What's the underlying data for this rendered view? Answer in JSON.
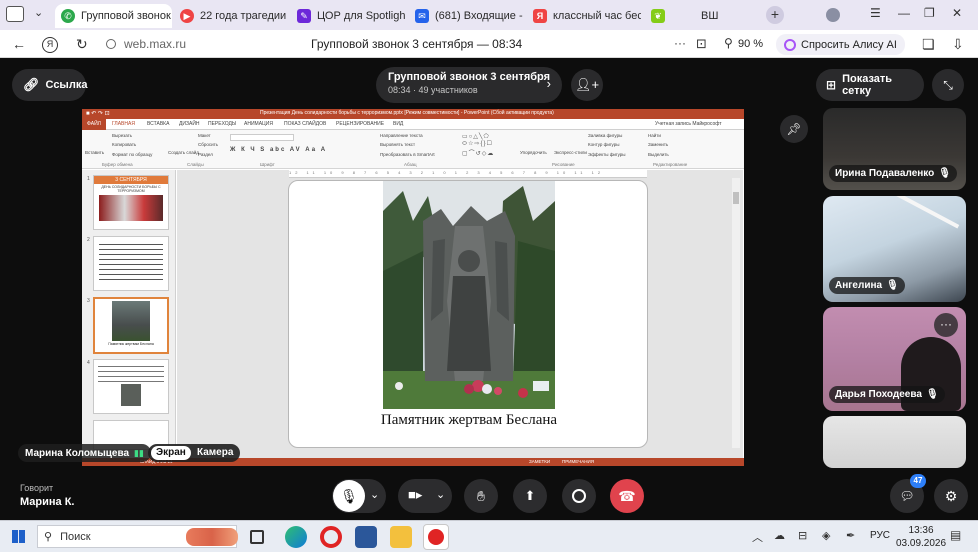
{
  "browser": {
    "tabs": [
      {
        "label": "Групповой звонок",
        "active": true
      },
      {
        "label": "22 года трагедии в"
      },
      {
        "label": "ЦОР для Spotlight 2"
      },
      {
        "label": "(681) Входящие - П"
      },
      {
        "label": "классный час бесла"
      },
      {
        "label": "ВШ"
      }
    ],
    "url": "web.max.ru",
    "page_title": "Групповой звонок 3 сентября — 08:34",
    "zoom": "90 %",
    "alice_button": "Спросить Алису AI"
  },
  "call": {
    "link_button": "Ссылка",
    "title": "Групповой звонок 3 сентября",
    "subtitle": "08:34 · 49 участников",
    "grid_button": "Показать сетку",
    "presenter_name": "Марина Коломыцева",
    "view_toggle": {
      "screen": "Экран",
      "camera": "Камера"
    },
    "speaking_label": "Говорит",
    "speaking_name": "Марина К.",
    "chat_badge": "47"
  },
  "participants": [
    {
      "name": "Ирина Подаваленко"
    },
    {
      "name": "Ангелина"
    },
    {
      "name": "Дарья Походеева"
    }
  ],
  "ppt": {
    "title_bar": "Презентация День солидарности борьбы с терроризмом.pptx [Режим совместимости] - PowerPoint (Сбой активации продукта)",
    "account": "Учетная запись Майкрософт",
    "tabs": [
      "ФАЙЛ",
      "ГЛАВНАЯ",
      "ВСТАВКА",
      "ДИЗАЙН",
      "ПЕРЕХОДЫ",
      "АНИМАЦИЯ",
      "ПОКАЗ СЛАЙДОВ",
      "РЕЦЕНЗИРОВАНИЕ",
      "ВИД"
    ],
    "groups": [
      "Буфер обмена",
      "Слайды",
      "Шрифт",
      "Абзац",
      "Рисование",
      "Редактирование"
    ],
    "ribbon": {
      "paste": "Вставить",
      "cut": "Вырезать",
      "copy": "Копировать",
      "format": "Формат по образцу",
      "create": "Создать слайд",
      "layout": "Макет",
      "reset": "Сбросить",
      "section": "Раздел",
      "arrange": "Упорядочить",
      "quick_styles": "Экспресс-стили",
      "fill": "Заливка фигуры",
      "outline": "Контур фигуры",
      "effects": "Эффекты фигуры",
      "find": "Найти",
      "replace": "Заменить",
      "select": "Выделить",
      "text_dir": "Направление текста",
      "align_text": "Выровнять текст",
      "smartart": "Преобразовать в SmartArt"
    },
    "slide_numbers": [
      "1",
      "2",
      "3",
      "4"
    ],
    "thumb1_date": "3 СЕНТЯБРЯ",
    "thumb1_subtitle": "ДЕНЬ СОЛИДАРНОСТИ БОРЬБЫ С ТЕРРОРИЗМОМ",
    "thumb3_caption": "Памятник жертвам Беслана",
    "main_caption": "Памятник жертвам Беслана",
    "status_left": "СЛАЙД 3 ИЗ 14",
    "status_notes": "ЗАМЕТКИ",
    "status_comments": "ПРИМЕЧАНИЯ"
  },
  "taskbar": {
    "search": "Поиск",
    "lang": "РУС",
    "time": "13:36",
    "date": "03.09.2026"
  },
  "colors": {
    "ppt_red": "#b7472a",
    "call_bg": "#0d0d0d",
    "hangup": "#e0434d",
    "accent": "#2d7ff9"
  }
}
